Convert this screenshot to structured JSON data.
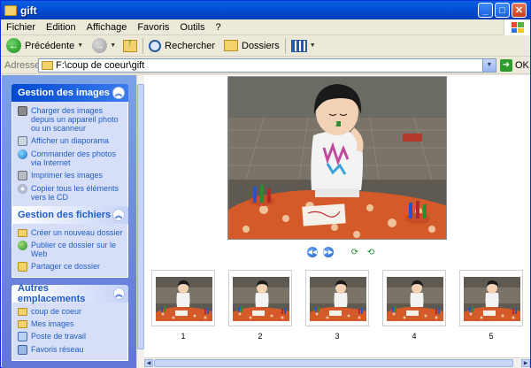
{
  "window": {
    "title": "gift"
  },
  "menu": [
    "Fichier",
    "Edition",
    "Affichage",
    "Favoris",
    "Outils",
    "?"
  ],
  "toolbar": {
    "back_label": "Précédente",
    "search_label": "Rechercher",
    "folders_label": "Dossiers"
  },
  "address": {
    "label": "Adresse",
    "value": "F:\\coup de coeur\\gift",
    "go_label": "OK"
  },
  "panels": {
    "images": {
      "title": "Gestion des images",
      "tasks": [
        {
          "label": "Charger des images depuis un appareil photo ou un scanneur",
          "icon": "camera-icon"
        },
        {
          "label": "Afficher un diaporama",
          "icon": "slideshow-icon"
        },
        {
          "label": "Commander des photos via Internet",
          "icon": "globe-icon"
        },
        {
          "label": "Imprimer les images",
          "icon": "printer-icon"
        },
        {
          "label": "Copier tous les éléments vers le CD",
          "icon": "cd-icon"
        }
      ]
    },
    "files": {
      "title": "Gestion des fichiers",
      "tasks": [
        {
          "label": "Créer un nouveau dossier",
          "icon": "new-folder-icon"
        },
        {
          "label": "Publier ce dossier sur le Web",
          "icon": "web-publish-icon"
        },
        {
          "label": "Partager ce dossier",
          "icon": "share-folder-icon"
        }
      ]
    },
    "places": {
      "title": "Autres emplacements",
      "items": [
        {
          "label": "coup de coeur",
          "icon": "folder-icon"
        },
        {
          "label": "Mes images",
          "icon": "folder-icon"
        },
        {
          "label": "Poste de travail",
          "icon": "computer-icon"
        },
        {
          "label": "Favoris réseau",
          "icon": "network-icon"
        }
      ]
    }
  },
  "thumbnails": [
    "1",
    "2",
    "3",
    "4",
    "5"
  ],
  "colors": {
    "title_bar": "#0450d8",
    "task_pane": "#6f8fe0",
    "link": "#215dc6"
  }
}
